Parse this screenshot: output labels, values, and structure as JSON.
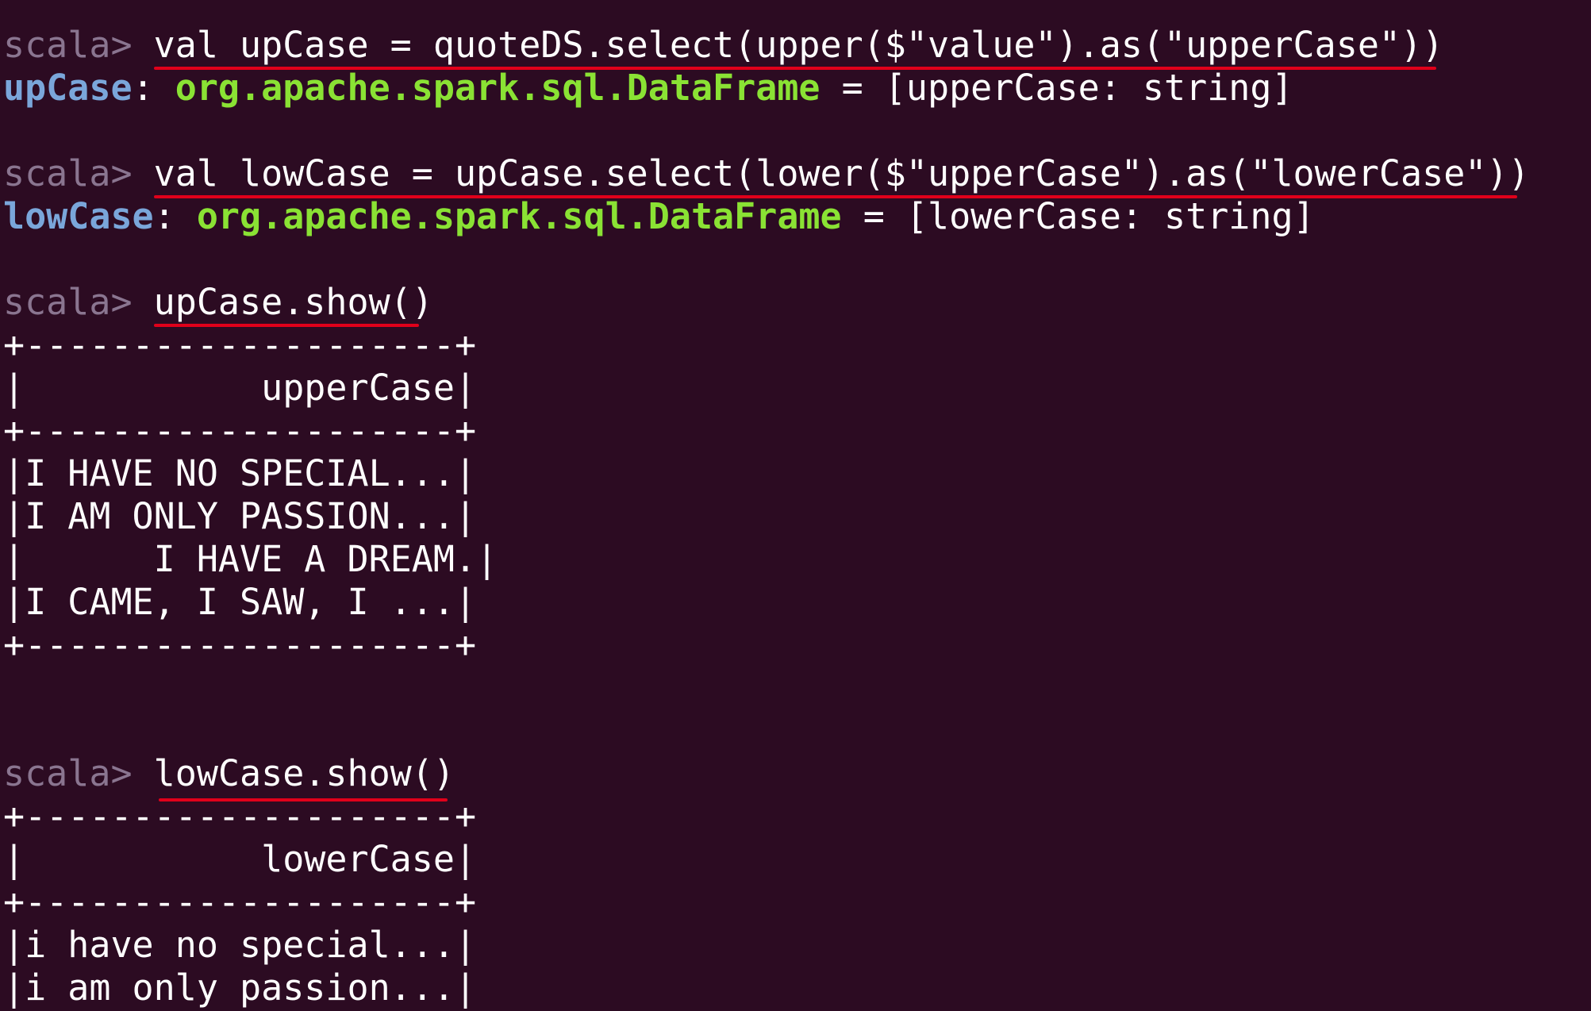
{
  "prompt": "scala>",
  "commands": [
    {
      "input": "val upCase = quoteDS.select(upper($\"value\").as(\"upperCase\"))"
    },
    {
      "input": "val lowCase = upCase.select(lower($\"upperCase\").as(\"lowerCase\"))"
    },
    {
      "input": "upCase.show()"
    },
    {
      "input": "lowCase.show()"
    }
  ],
  "results": [
    {
      "var": "upCase",
      "sep": ":",
      "type": "org.apache.spark.sql.DataFrame",
      "rest": " = [upperCase: string]"
    },
    {
      "var": "lowCase",
      "sep": ":",
      "type": "org.apache.spark.sql.DataFrame",
      "rest": " = [lowerCase: string]"
    }
  ],
  "tables": [
    {
      "border": "+--------------------+",
      "header": "|           upperCase|",
      "rows": [
        "|I HAVE NO SPECIAL...|",
        "|I AM ONLY PASSION...|",
        "|      I HAVE A DREAM.|",
        "|I CAME, I SAW, I ...|"
      ]
    },
    {
      "border": "+--------------------+",
      "header": "|           lowerCase|",
      "rows": [
        "|i have no special...|",
        "|i am only passion...|"
      ]
    }
  ],
  "colors": {
    "background": "#2c0b22",
    "prompt": "#8a7590",
    "variable": "#7aa6da",
    "type": "#8ae234",
    "text": "#ffffff",
    "annotation_underline": "#e0001a"
  }
}
